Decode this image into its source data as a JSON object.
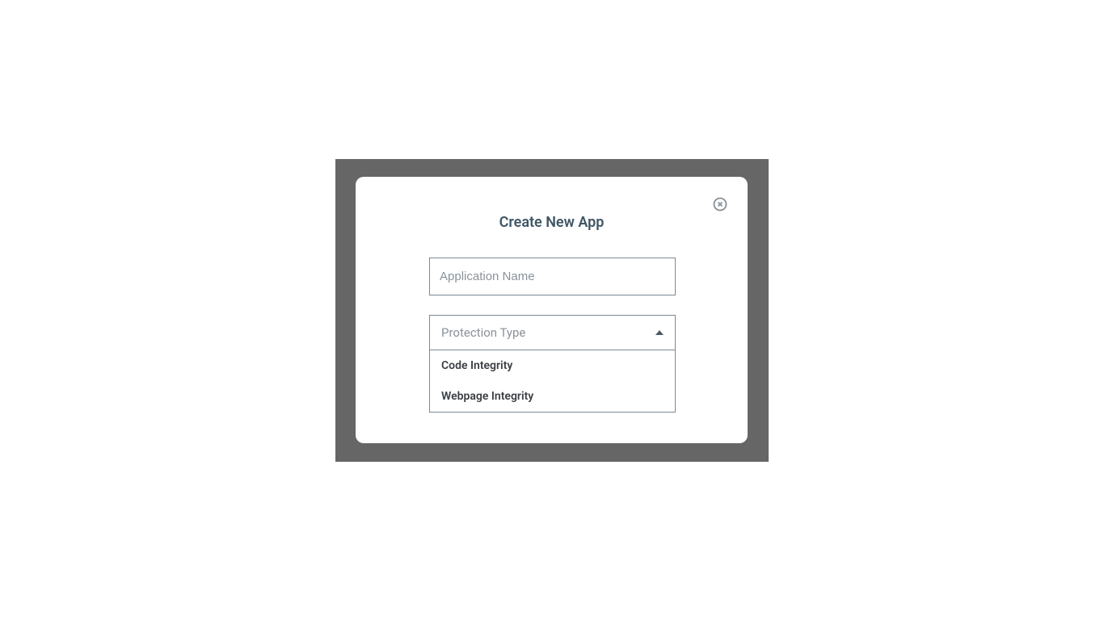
{
  "modal": {
    "title": "Create New App",
    "name_placeholder": "Application Name",
    "name_value": "",
    "protection_placeholder": "Protection Type",
    "options": [
      "Code Integrity",
      "Webpage Integrity"
    ]
  }
}
